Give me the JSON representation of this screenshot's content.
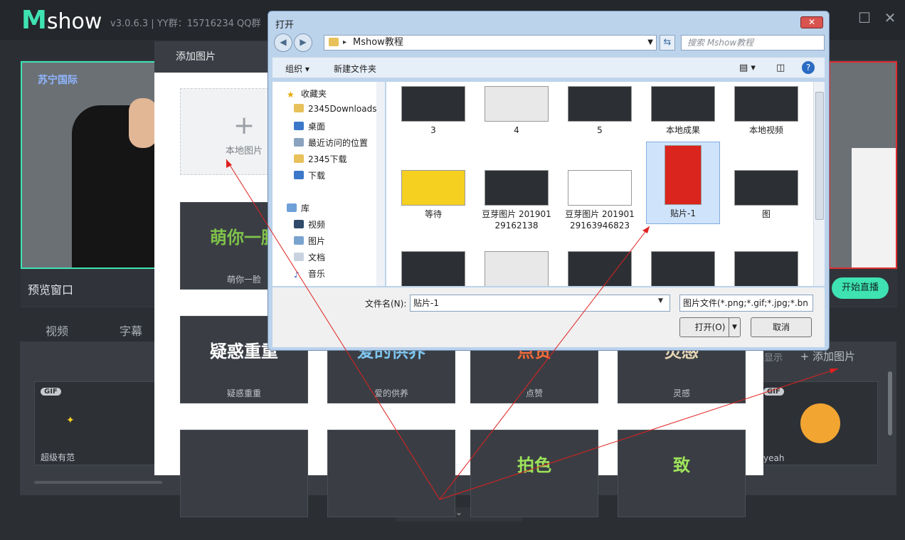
{
  "app": {
    "logo_m": "M",
    "logo_text": "show",
    "version_info": "v3.0.6.3 | YY群：15716234 QQ群"
  },
  "preview": {
    "label": "预览窗口",
    "brand": "苏宁国际",
    "live_button": "开始直播"
  },
  "tabs": [
    "视频",
    "字幕"
  ],
  "gallery": {
    "live_display": "直播显示",
    "add_image": "添加图片",
    "add_image_plus": "+",
    "gif_badge": "GIF",
    "items": [
      {
        "label": "超级有范"
      },
      {
        "label": "yeah"
      }
    ]
  },
  "add_dialog": {
    "title": "添加图片",
    "local_plus": "+",
    "local_label": "本地图片",
    "stickers": [
      {
        "label": "萌你一脸",
        "art": "萌你一脸",
        "color": "#7fc24a"
      },
      {
        "label": "疑惑重重",
        "art": "疑惑重重",
        "color": "#ffffff"
      },
      {
        "label": "爱的供养",
        "art": "爱的供养",
        "color": "#7ec6f0"
      },
      {
        "label": "点赞",
        "art": "点赞",
        "color": "#f26b3a"
      },
      {
        "label": "灵感",
        "art": "灵感",
        "color": "#e8d7b6"
      },
      {
        "label": "",
        "art": "",
        "color": "#ffffff"
      },
      {
        "label": "",
        "art": "",
        "color": "#8fd0ff"
      },
      {
        "label": "",
        "art": "拍色",
        "color": "#9ee35a"
      },
      {
        "label": "",
        "art": "致",
        "color": "#9ee35a"
      }
    ]
  },
  "open_dialog": {
    "title": "打开",
    "close": "✕",
    "path_folder": "Mshow教程",
    "search_placeholder": "搜索 Mshow教程",
    "toolbar": {
      "organize": "组织 ▾",
      "new_folder": "新建文件夹"
    },
    "nav": {
      "favorites": "收藏夹",
      "fav_items": [
        "2345Downloads",
        "桌面",
        "最近访问的位置",
        "2345下载",
        "下载"
      ],
      "library": "库",
      "lib_items": [
        "视频",
        "图片",
        "文档",
        "音乐"
      ]
    },
    "files": [
      {
        "label": "3"
      },
      {
        "label": "4"
      },
      {
        "label": "5"
      },
      {
        "label": "本地成果"
      },
      {
        "label": "本地视频"
      },
      {
        "label": "等待"
      },
      {
        "label": "豆芽图片 20190129162138"
      },
      {
        "label": "豆芽图片 20190129163946823"
      },
      {
        "label": "贴片-1"
      },
      {
        "label": "图"
      },
      {
        "label": ""
      },
      {
        "label": ""
      },
      {
        "label": ""
      },
      {
        "label": ""
      },
      {
        "label": ""
      }
    ],
    "filename_label": "文件名(N):",
    "filename_value": "贴片-1",
    "filetype_value": "图片文件(*.png;*.gif;*.jpg;*.bn",
    "open_button": "打开(O)",
    "cancel_button": "取消"
  }
}
